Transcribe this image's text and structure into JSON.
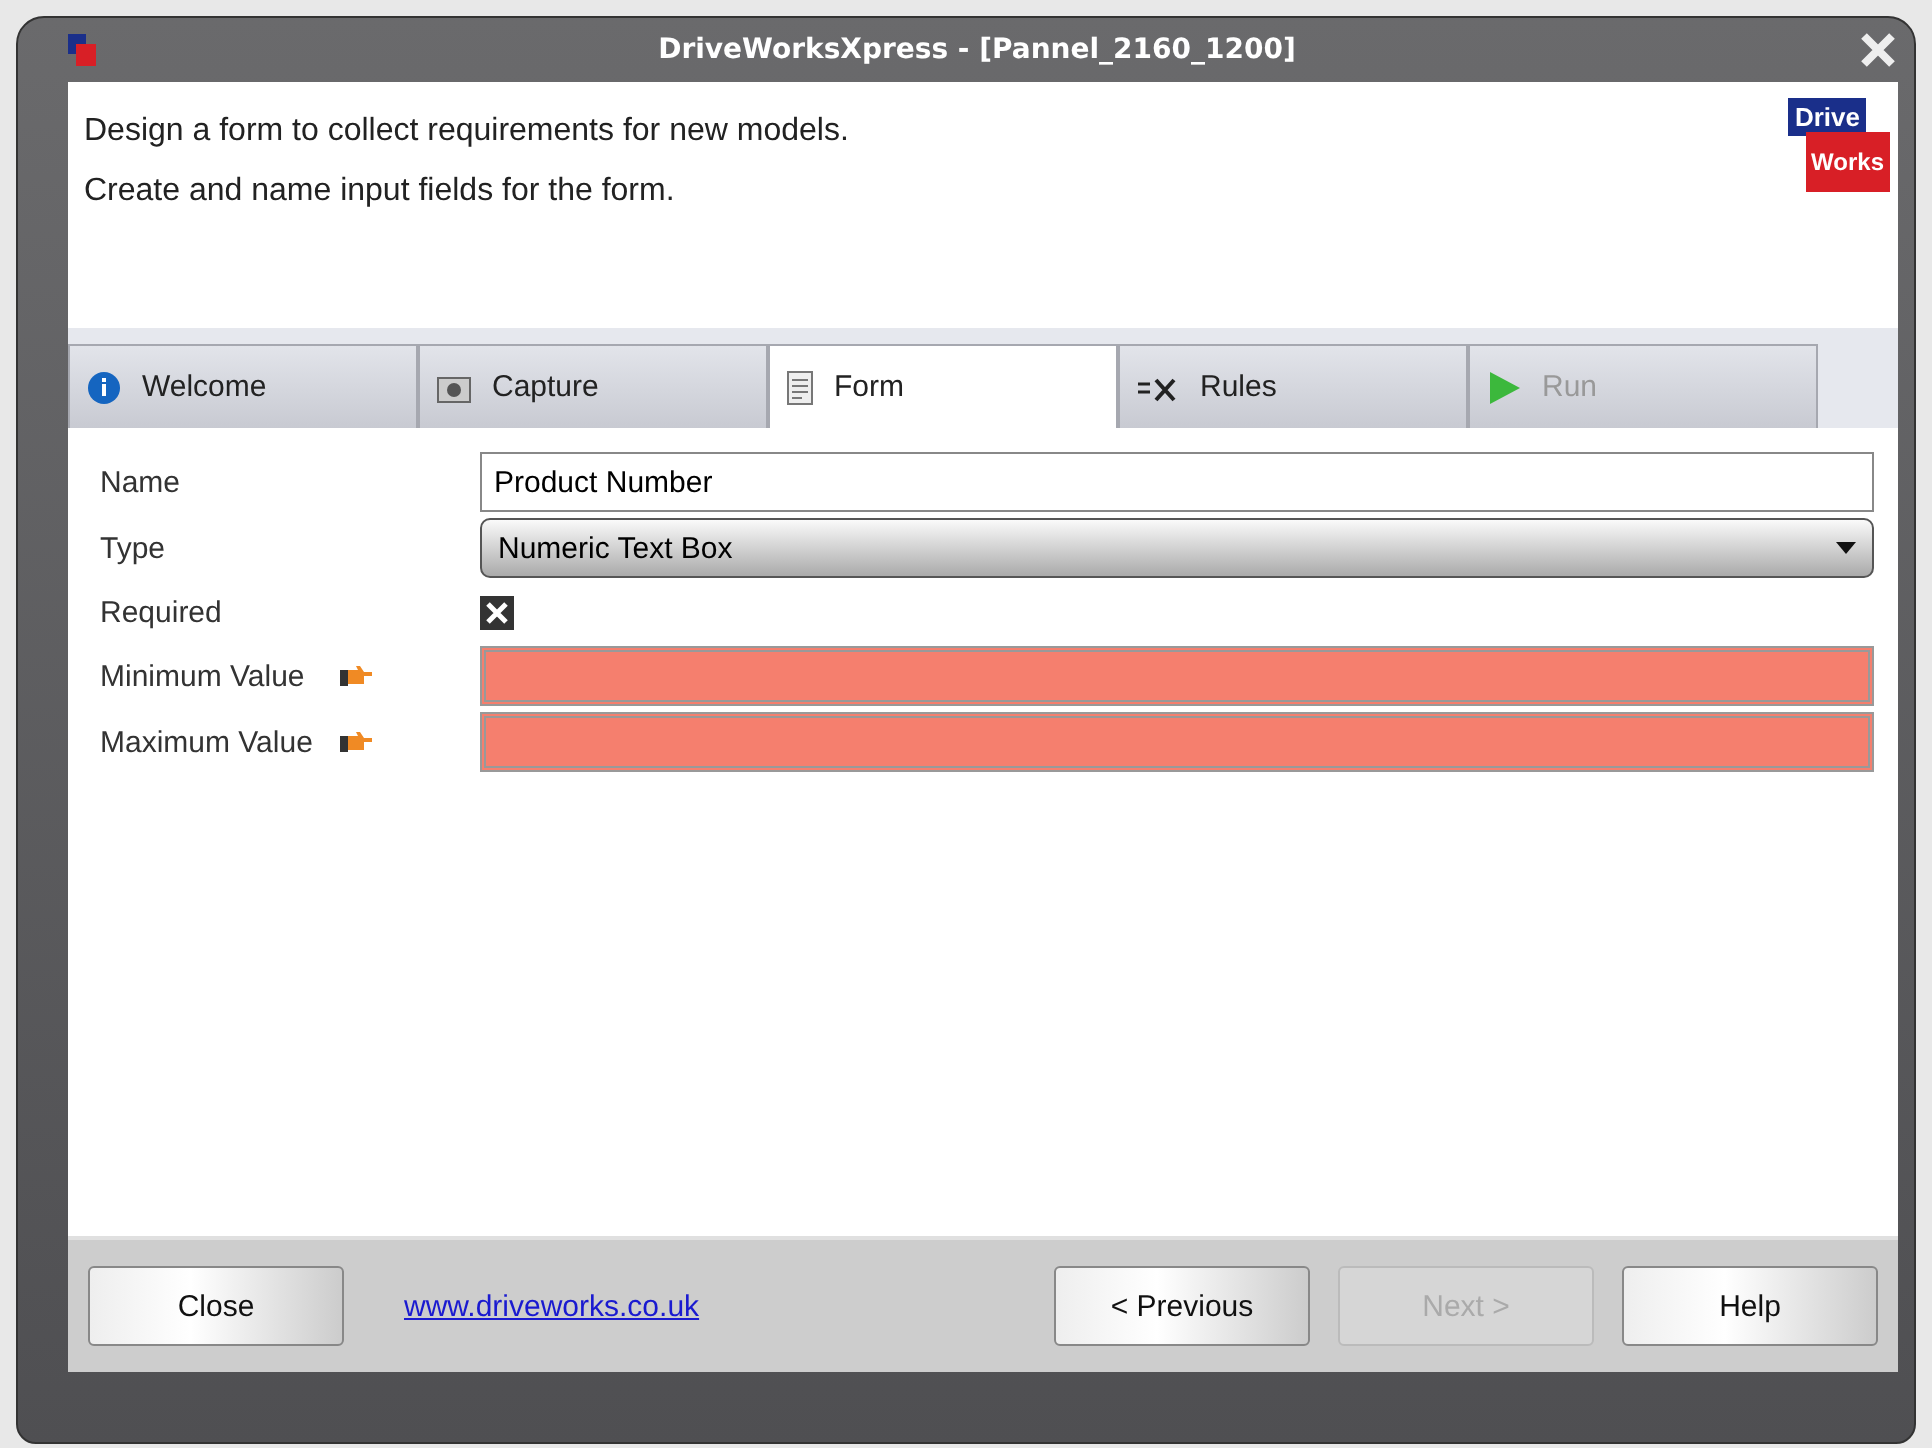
{
  "window": {
    "title": "DriveWorksXpress - [Pannel_2160_1200]"
  },
  "header": {
    "lines": [
      "Design a form to collect requirements for new models.",
      "Create and name input fields for the form."
    ],
    "logo": [
      "Drive",
      "Works"
    ]
  },
  "tabs": [
    {
      "label": "Welcome",
      "kind": "info",
      "selected": false,
      "disabled": false
    },
    {
      "label": "Capture",
      "kind": "camera",
      "selected": false,
      "disabled": false
    },
    {
      "label": "Form",
      "kind": "form",
      "selected": true,
      "disabled": false
    },
    {
      "label": "Rules",
      "kind": "formula",
      "selected": false,
      "disabled": false
    },
    {
      "label": "Run",
      "kind": "play",
      "selected": false,
      "disabled": true
    }
  ],
  "fields": [
    {
      "label": "Name",
      "kind": "text",
      "value": "Product Number",
      "error": false
    },
    {
      "label": "Type",
      "kind": "dropdown",
      "value": "Numeric Text Box"
    },
    {
      "label": "Required",
      "kind": "checkbox",
      "checked": true
    },
    {
      "label": "Minimum Value",
      "kind": "text",
      "error": true
    },
    {
      "label": "Maximum Value",
      "kind": "text",
      "error": true
    }
  ],
  "footer": {
    "buttons": [
      {
        "label": "Close",
        "disabled": false
      },
      {
        "label": "< Previous",
        "disabled": false
      },
      {
        "label": "Next >",
        "disabled": true
      },
      {
        "label": "Help",
        "disabled": false
      }
    ],
    "link": "www.driveworks.co.uk"
  }
}
